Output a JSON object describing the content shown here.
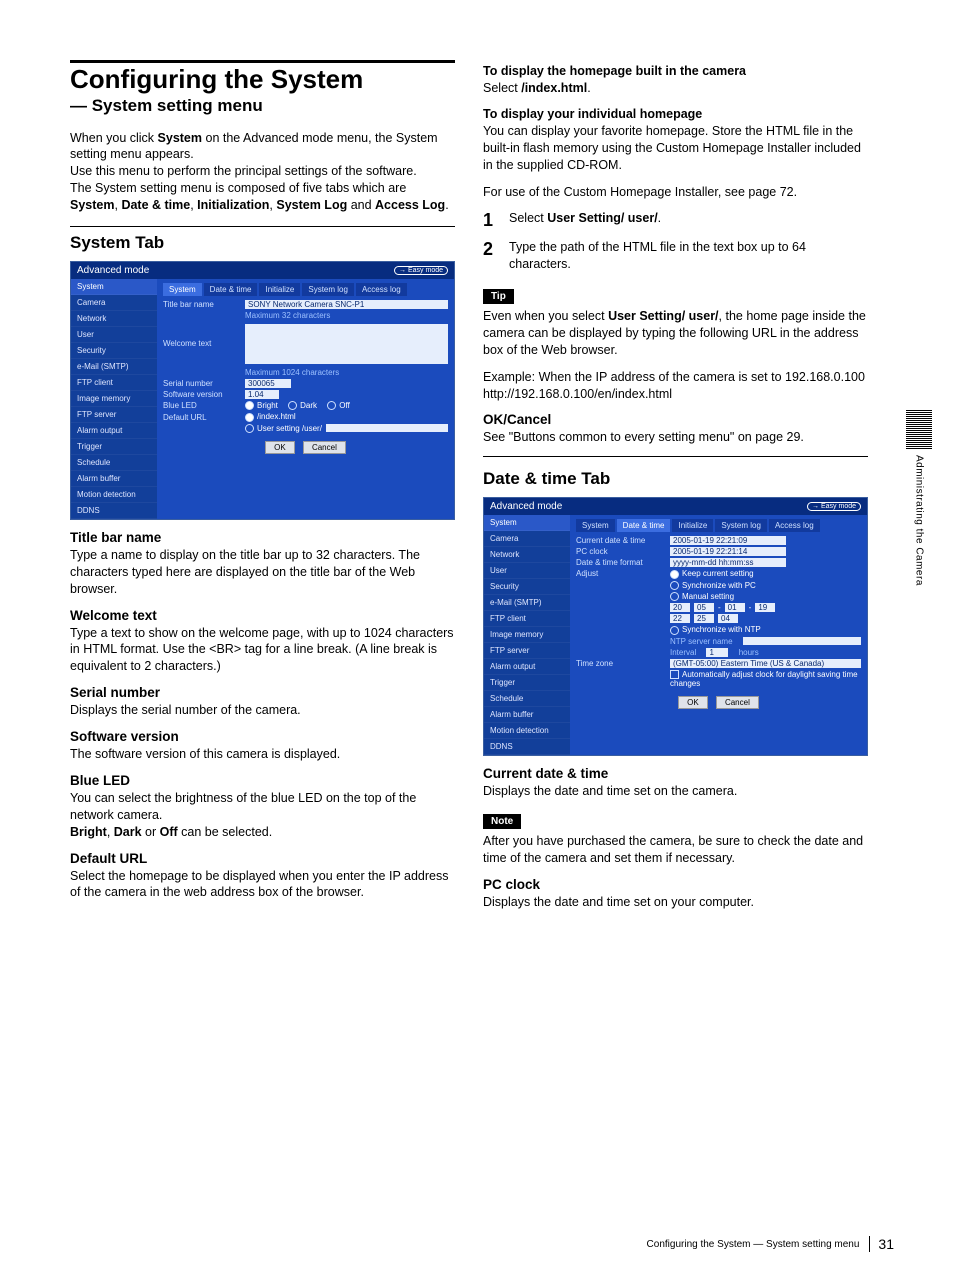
{
  "page": {
    "title": "Configuring the System",
    "subtitle": "— System setting menu",
    "intro1": "When you click System on the Advanced mode menu, the System setting menu appears.",
    "intro2": "Use this menu to perform the principal settings of the software.",
    "intro3": "The System setting menu is composed of five tabs which are System, Date & time, Initialization, System Log and Access Log."
  },
  "systemTab": {
    "heading": "System Tab",
    "shot": {
      "mode": "Advanced mode",
      "easy": "→ Easy mode",
      "side": [
        "System",
        "Camera",
        "Network",
        "User",
        "Security",
        "e-Mail (SMTP)",
        "FTP client",
        "Image memory",
        "FTP server",
        "Alarm output",
        "Trigger",
        "Schedule",
        "Alarm buffer",
        "Motion detection",
        "DDNS"
      ],
      "tabs": [
        "System",
        "Date & time",
        "Initialize",
        "System log",
        "Access log"
      ],
      "fields": {
        "titleBarName": {
          "label": "Title bar name",
          "value": "SONY Network Camera SNC-P1",
          "hint": "Maximum 32 characters"
        },
        "welcome": {
          "label": "Welcome text",
          "hint": "Maximum 1024 characters"
        },
        "serial": {
          "label": "Serial number",
          "value": "300065"
        },
        "swver": {
          "label": "Software version",
          "value": "1.04"
        },
        "blueLed": {
          "label": "Blue LED",
          "opts": [
            "Bright",
            "Dark",
            "Off"
          ]
        },
        "defaultUrl": {
          "label": "Default URL",
          "opt1": "/index.html",
          "opt2": "User setting /user/"
        }
      },
      "buttons": {
        "ok": "OK",
        "cancel": "Cancel"
      }
    },
    "sections": {
      "titleBar": {
        "h": "Title bar name",
        "p": "Type a name to display on the title bar up to 32 characters. The characters typed here are displayed on the title bar of the Web browser."
      },
      "welcome": {
        "h": "Welcome text",
        "p": "Type a text to show on the welcome page, with up to 1024 characters in HTML format.  Use the <BR> tag for a line break. (A line break is equivalent to 2 characters.)"
      },
      "serial": {
        "h": "Serial number",
        "p": "Displays the serial number of the camera."
      },
      "swver": {
        "h": "Software version",
        "p": "The software version of this camera is displayed."
      },
      "blueLed": {
        "h": "Blue LED",
        "p1": "You can select the brightness of the blue LED on the top of the network camera.",
        "p2": "Bright, Dark or Off can be selected."
      },
      "defaultUrl": {
        "h": "Default URL",
        "p": "Select the homepage to be displayed when you enter the IP address of the camera in the web address box of the browser."
      }
    }
  },
  "right": {
    "homeBuilt": {
      "h": "To display the homepage built in the camera",
      "p": "Select /index.html."
    },
    "homeOwn": {
      "h": "To display your individual homepage",
      "p1": "You can display your favorite homepage. Store the HTML file in the built-in flash memory using the Custom Homepage Installer included in the supplied CD-ROM.",
      "p2": "For use of the Custom Homepage Installer, see page 72."
    },
    "steps": {
      "s1": "Select User Setting/ user/.",
      "s2": "Type the path of the HTML file in the text box up to 64 characters."
    },
    "tipLabel": "Tip",
    "tip": {
      "p1": "Even when you select User Setting/ user/, the home page inside the camera can be displayed by typing the following URL in the address box of the Web browser.",
      "p2": "Example: When the IP address of the camera is set to 192.168.0.100",
      "p3": "http://192.168.0.100/en/index.html"
    },
    "okcancel": {
      "h": "OK/Cancel",
      "p": "See \"Buttons common to every setting menu\" on page 29."
    }
  },
  "dateTab": {
    "heading": "Date & time Tab",
    "shot": {
      "mode": "Advanced mode",
      "easy": "→ Easy mode",
      "side": [
        "System",
        "Camera",
        "Network",
        "User",
        "Security",
        "e-Mail (SMTP)",
        "FTP client",
        "Image memory",
        "FTP server",
        "Alarm output",
        "Trigger",
        "Schedule",
        "Alarm buffer",
        "Motion detection",
        "DDNS"
      ],
      "tabs": [
        "System",
        "Date & time",
        "Initialize",
        "System log",
        "Access log"
      ],
      "fields": {
        "cur": {
          "label": "Current date & time",
          "value": "2005-01-19  22:21:09"
        },
        "pc": {
          "label": "PC clock",
          "value": "2005-01-19  22:21:14"
        },
        "fmt": {
          "label": "Date & time format",
          "value": "yyyy-mm-dd hh:mm:ss"
        },
        "adjust": {
          "label": "Adjust",
          "o1": "Keep current setting",
          "o2": "Synchronize with PC",
          "o3": "Manual setting",
          "manual": [
            "20",
            "05",
            "-",
            "01",
            "-",
            "19",
            "22",
            "25",
            "04"
          ],
          "o4": "Synchronize with NTP",
          "ntp": "NTP server name",
          "interval": "Interval",
          "intervalVal": "1",
          "intervalUnit": "hours"
        },
        "tz": {
          "label": "Time zone",
          "value": "(GMT-05:00) Eastern Time (US & Canada)",
          "auto": "Automatically adjust clock for daylight saving time changes"
        }
      },
      "buttons": {
        "ok": "OK",
        "cancel": "Cancel"
      }
    },
    "sections": {
      "cur": {
        "h": "Current date & time",
        "p": "Displays the date and time set on the camera."
      },
      "noteLabel": "Note",
      "note": "After you have purchased the camera, be sure to check the date and time of the camera and set them if necessary.",
      "pc": {
        "h": "PC clock",
        "p": "Displays the date and time set on your computer."
      }
    }
  },
  "marginTab": "Administrating the Camera",
  "footer": {
    "title": "Configuring the System — System setting menu",
    "page": "31"
  }
}
